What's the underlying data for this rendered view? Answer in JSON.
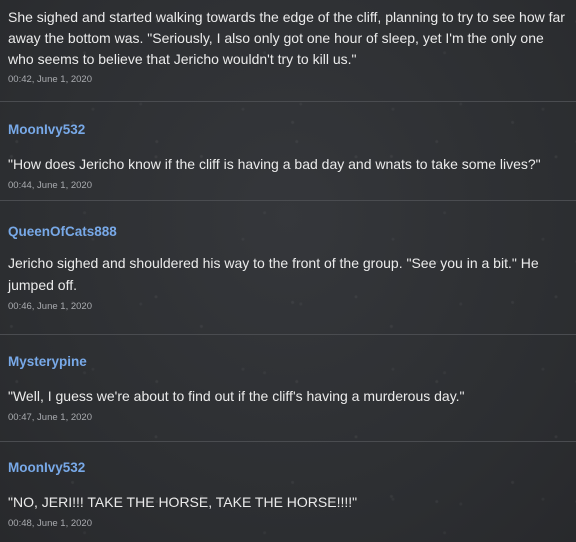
{
  "comments": [
    {
      "username": "",
      "text": "She sighed and started walking towards the edge of the cliff, planning to try to see how far away the bottom was. \"Seriously, I also only got one hour of sleep, yet I'm the only one who seems to believe that Jericho wouldn't try to kill us.\"",
      "timestamp": "00:42, June 1, 2020"
    },
    {
      "username": "MoonIvy532",
      "text": "\"How does Jericho know if the cliff is having a bad day and wnats to take some lives?\"",
      "timestamp": "00:44, June 1, 2020"
    },
    {
      "username": "QueenOfCats888",
      "text": "Jericho sighed and shouldered his way to the front of the group. \"See you in a bit.\" He jumped off.",
      "timestamp": "00:46, June 1, 2020"
    },
    {
      "username": "Mysterypine",
      "text": "\"Well, I guess we're about to find out if the cliff's having a murderous day.\"",
      "timestamp": "00:47, June 1, 2020"
    },
    {
      "username": "MoonIvy532",
      "text": "\"NO, JERI!!! TAKE THE HORSE, TAKE THE HORSE!!!!\"",
      "timestamp": "00:48, June 1, 2020"
    }
  ]
}
